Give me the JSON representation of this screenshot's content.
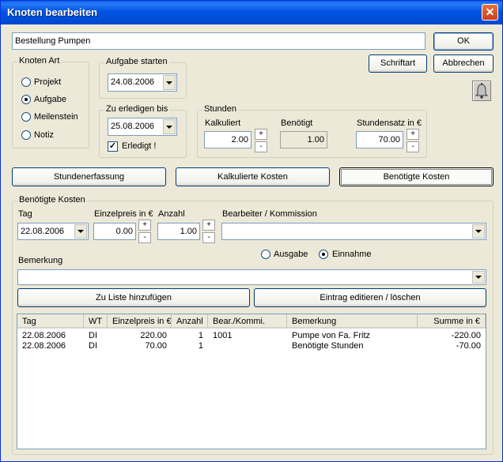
{
  "window": {
    "title": "Knoten bearbeiten",
    "close_glyph": "✕"
  },
  "name_field": {
    "value": "Bestellung Pumpen"
  },
  "buttons": {
    "ok": "OK",
    "font": "Schriftart",
    "cancel": "Abbrechen",
    "bell_icon": "bell-icon"
  },
  "knoten_art": {
    "title": "Knoten Art",
    "options": [
      "Projekt",
      "Aufgabe",
      "Meilenstein",
      "Notiz"
    ],
    "selected": "Aufgabe"
  },
  "aufgabe_starten": {
    "title": "Aufgabe starten",
    "date": "24.08.2006"
  },
  "zu_erledigen": {
    "title": "Zu erledigen bis",
    "date": "25.08.2006",
    "done_label": "Erledigt !",
    "done_checked": true
  },
  "stunden": {
    "title": "Stunden",
    "kalkuliert_label": "Kalkuliert",
    "kalkuliert_value": "2.00",
    "benoetigt_label": "Benötigt",
    "benoetigt_value": "1.00",
    "satz_label": "Stundensatz in €",
    "satz_value": "70.00",
    "plus": "+",
    "minus": "-"
  },
  "tabs": [
    "Stundenerfassung",
    "Kalkulierte Kosten",
    "Benötigte Kosten"
  ],
  "active_tab": "Benötigte Kosten",
  "kosten": {
    "title": "Benötigte Kosten",
    "tag_label": "Tag",
    "tag_value": "22.08.2006",
    "einzelpreis_label": "Einzelpreis in €",
    "einzelpreis_value": "0.00",
    "anzahl_label": "Anzahl",
    "anzahl_value": "1.00",
    "bearbeiter_label": "Bearbeiter / Kommission",
    "bearbeiter_value": "",
    "ausgabe_label": "Ausgabe",
    "einnahme_label": "Einnahme",
    "selected_type": "Einnahme",
    "bemerkung_label": "Bemerkung",
    "bemerkung_value": "",
    "add_button": "Zu Liste hinzufügen",
    "edit_button": "Eintrag editieren / löschen",
    "plus": "+",
    "minus": "-"
  },
  "table": {
    "columns": [
      "Tag",
      "WT",
      "Einzelpreis in €",
      "Anzahl",
      "Bear./Kommi.",
      "Bemerkung",
      "Summe in €"
    ],
    "rows": [
      [
        "22.08.2006",
        "DI",
        "220.00",
        "1",
        "1001",
        "Pumpe von Fa. Fritz",
        "-220.00"
      ],
      [
        "22.08.2006",
        "DI",
        "70.00",
        "1",
        "",
        "Benötigte Stunden",
        "-70.00"
      ]
    ]
  }
}
